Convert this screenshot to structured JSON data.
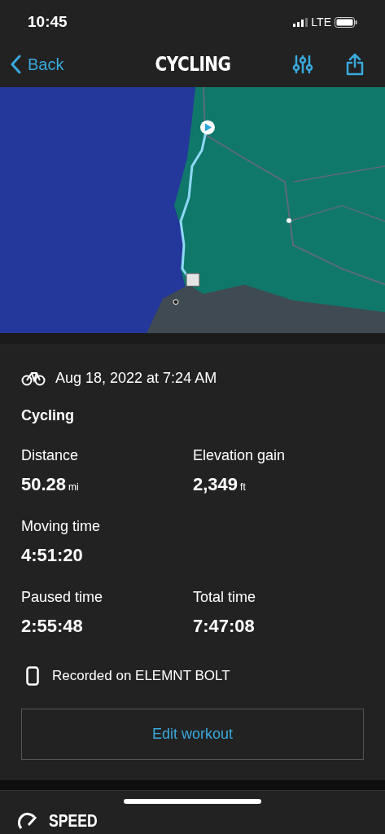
{
  "status_bar": {
    "time": "10:45",
    "network": "LTE"
  },
  "nav": {
    "back": "Back",
    "title": "CYCLING"
  },
  "workout": {
    "date": "Aug 18, 2022 at 7:24 AM",
    "type": "Cycling",
    "stat_rows": [
      [
        {
          "label": "Distance",
          "value": "50.28",
          "unit": "mi"
        },
        {
          "label": "Elevation gain",
          "value": "2,349",
          "unit": "ft"
        }
      ],
      [
        {
          "label": "Moving time",
          "value": "4:51:20"
        }
      ],
      [
        {
          "label": "Paused time",
          "value": "2:55:48"
        },
        {
          "label": "Total time",
          "value": "7:47:08"
        }
      ]
    ],
    "device": "Recorded on ELEMNT BOLT",
    "edit_button": "Edit workout"
  },
  "next_section": {
    "title": "SPEED"
  }
}
